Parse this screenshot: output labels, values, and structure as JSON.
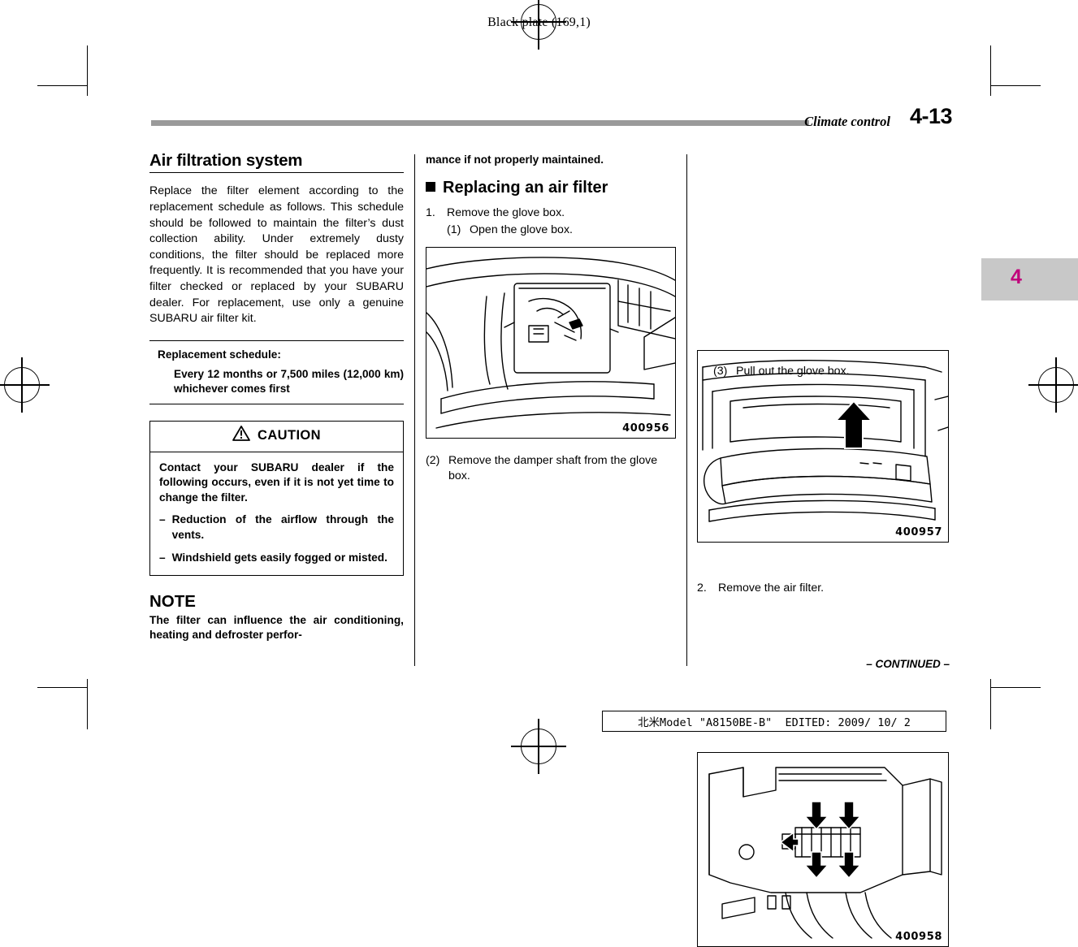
{
  "page": {
    "black_plate": "Black plate (169,1)",
    "chapter_label": "Climate control",
    "page_number": "4-13",
    "chapter_tab_number": "4",
    "continued": "– CONTINUED –",
    "footer": "北米Model \"A8150BE-B\"  EDITED: 2009/ 10/ 2"
  },
  "column1": {
    "title": "Air filtration system",
    "intro": "Replace the filter element according to the replacement schedule as follows. This schedule should be followed to maintain the filter’s dust collection ability. Under extremely dusty conditions, the filter should be replaced more frequently. It is recommended that you have your filter checked or replaced by your SUBARU dealer. For replacement, use only a genuine SUBARU air filter kit.",
    "schedule_title": "Replacement schedule:",
    "schedule_text": "Every 12 months or 7,500 miles (12,000 km) whichever comes first",
    "caution_label": "CAUTION",
    "caution_icon": "warning-triangle-icon",
    "caution_body": "Contact your SUBARU dealer if the following occurs, even if it is not yet time to change the filter.",
    "caution_items": [
      {
        "dash": "–",
        "text": "Reduction of the airflow through the vents."
      },
      {
        "dash": "–",
        "text": "Windshield gets easily fogged or misted."
      }
    ],
    "note_title": "NOTE",
    "note_body": "The filter can influence the air conditioning, heating and defroster perfor-"
  },
  "column2": {
    "continued_text": "mance if not properly maintained.",
    "sub_head": "Replacing an air filter",
    "step1_num": "1.",
    "step1_text": "Remove the glove box.",
    "substep1_num": "(1)",
    "substep1_text": "Open the glove box.",
    "figure1_id": "400956",
    "caption2_num": "(2)",
    "caption2_text": "Remove the damper shaft from the glove box."
  },
  "column3": {
    "figure2_id": "400957",
    "caption3_num": "(3)",
    "caption3_text": "Pull out the glove box.",
    "figure3_id": "400958",
    "step2_num": "2.",
    "step2_text": "Remove the air filter."
  },
  "colors": {
    "header_rule": "#9a9a9a",
    "chapter_tab": "#c8c8c8",
    "chapter_tab_number": "#c0007a"
  }
}
